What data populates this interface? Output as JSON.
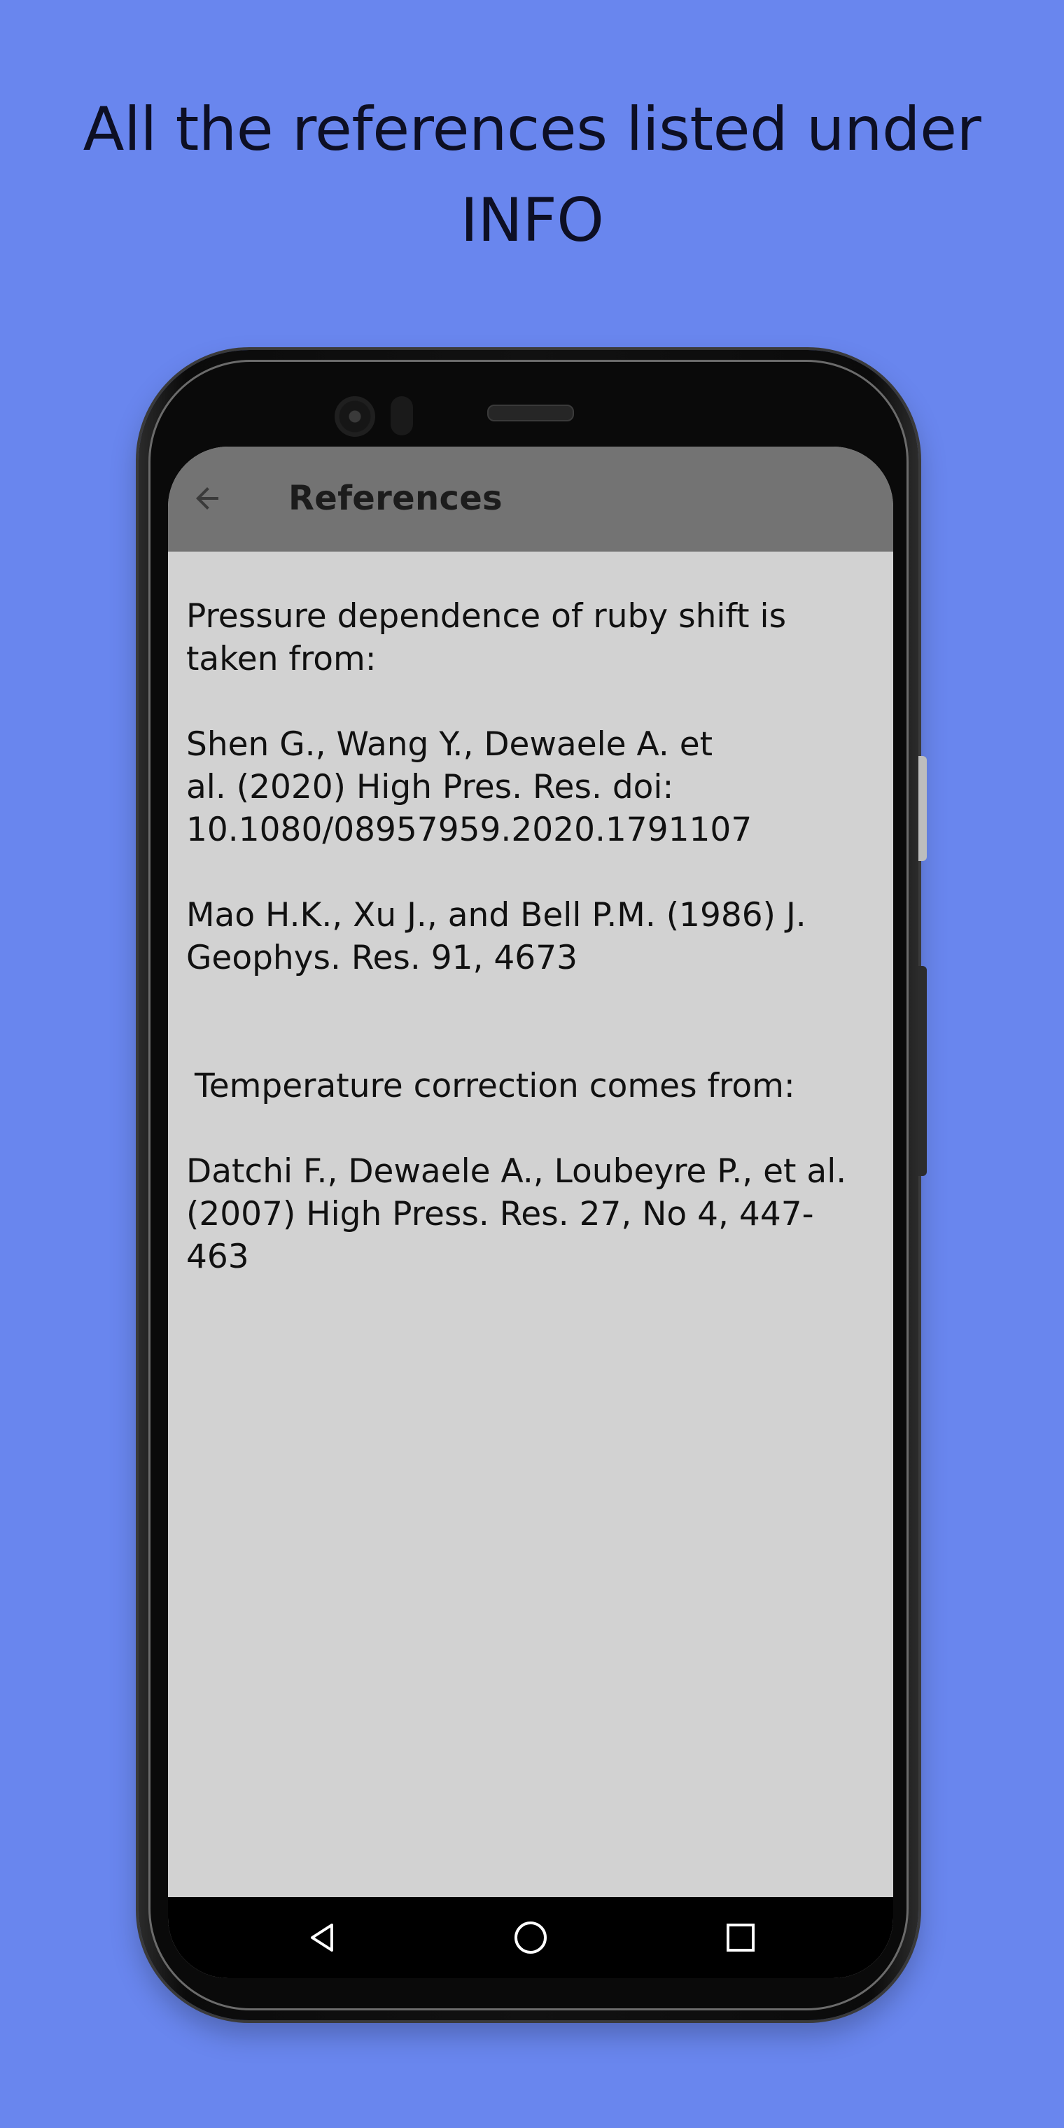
{
  "promo": {
    "caption": "All the references listed under INFO"
  },
  "app_bar": {
    "title": "References",
    "back_icon": "arrow-back-icon"
  },
  "content": {
    "intro": "Pressure dependence of ruby shift is taken from:",
    "ref1_line1": "Shen G., Wang Y., Dewaele A. et",
    "ref1_line2": "al. (2020) High Pres. Res. doi:",
    "ref1_line3": "10.1080/08957959.2020.1791107",
    "ref2": "Mao H.K., Xu J., and Bell P.M. (1986) J. Geophys. Res. 91, 4673",
    "temp_heading": "Temperature correction comes from:",
    "ref3": "Datchi F., Dewaele A., Loubeyre P., et al. (2007) High Press. Res. 27, No 4, 447-463"
  },
  "nav_bar": {
    "back_icon": "nav-back-triangle-icon",
    "home_icon": "nav-home-circle-icon",
    "recents_icon": "nav-recents-square-icon"
  },
  "colors": {
    "background": "#6986ee",
    "app_bar": "#737373",
    "screen": "#d2d2d2",
    "nav_bar": "#000000"
  }
}
